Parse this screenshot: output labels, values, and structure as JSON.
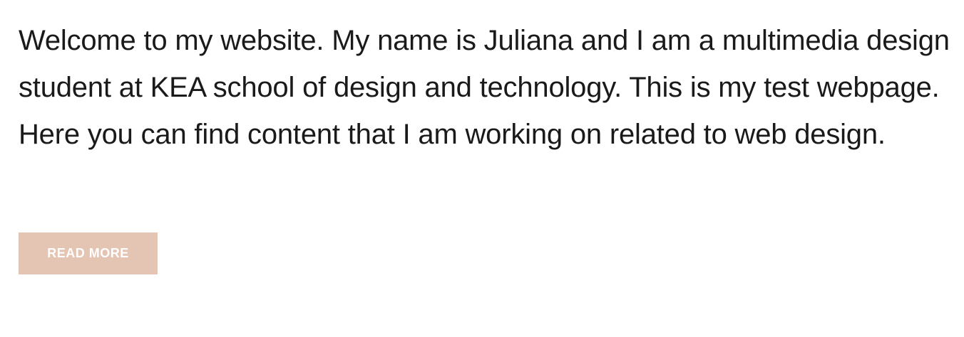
{
  "main": {
    "intro_text": "Welcome to my website. My name is Juliana and I am a multimedia design student at KEA school of design and technology. This is my test webpage. Here you can find content that I am working on related to web design.",
    "read_more_label": "READ MORE"
  },
  "colors": {
    "text": "#1a1a1a",
    "button_background": "#e4c4b3",
    "button_text": "#ffffff",
    "page_background": "#ffffff"
  }
}
